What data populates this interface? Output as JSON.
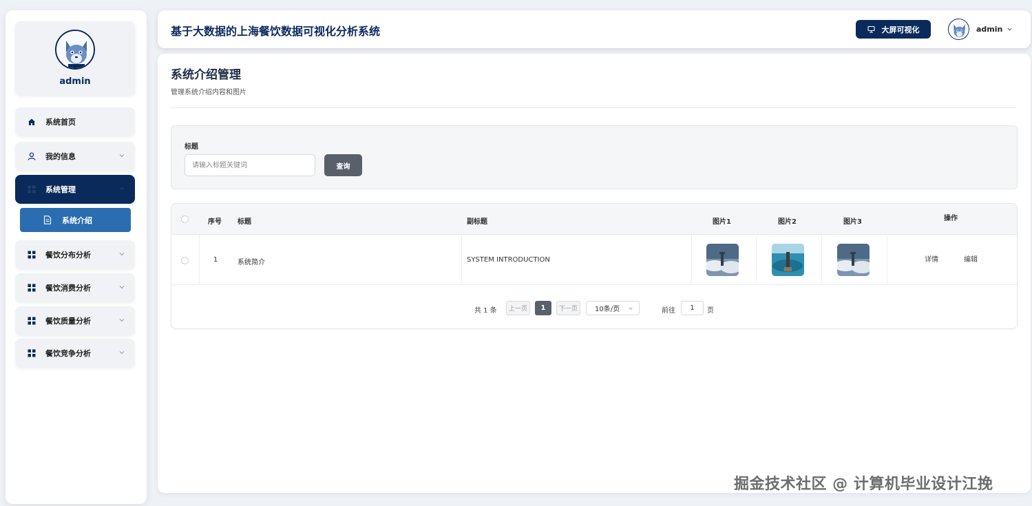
{
  "colors": {
    "navy": "#0b2a5c",
    "accent_blue": "#2a6db0",
    "button_gray": "#5a6069"
  },
  "sidebar": {
    "username": "admin",
    "items": [
      {
        "label": "系统首页",
        "icon": "home-icon"
      },
      {
        "label": "我的信息",
        "icon": "user-icon"
      },
      {
        "label": "系统管理",
        "icon": "grid-icon"
      },
      {
        "label": "餐饮分布分析",
        "icon": "grid-icon"
      },
      {
        "label": "餐饮消费分析",
        "icon": "grid-icon"
      },
      {
        "label": "餐饮质量分析",
        "icon": "grid-icon"
      },
      {
        "label": "餐饮竞争分析",
        "icon": "grid-icon"
      }
    ],
    "submenu": {
      "label": "系统介绍",
      "icon": "document-icon"
    }
  },
  "header": {
    "title": "基于大数据的上海餐饮数据可视化分析系统",
    "bigscreen_label": "大屏可视化",
    "username": "admin"
  },
  "page": {
    "title": "系统介绍管理",
    "subtitle": "管理系统介绍内容和图片"
  },
  "search": {
    "label": "标题",
    "placeholder": "请输入标题关键词",
    "button": "查询"
  },
  "table": {
    "headers": [
      "序号",
      "标题",
      "副标题",
      "图片1",
      "图片2",
      "图片3",
      "操作"
    ],
    "rows": [
      {
        "index": "1",
        "title": "系统简介",
        "subtitle": "SYSTEM INTRODUCTION",
        "detail": "详情",
        "edit": "编辑"
      }
    ]
  },
  "pagination": {
    "total": "共 1 条",
    "prev": "上一页",
    "current": "1",
    "next": "下一页",
    "page_size": "10条/页",
    "goto_label": "前往",
    "goto_value": "1",
    "page_suffix": "页"
  },
  "watermark": "掘金技术社区 @ 计算机毕业设计江挽"
}
